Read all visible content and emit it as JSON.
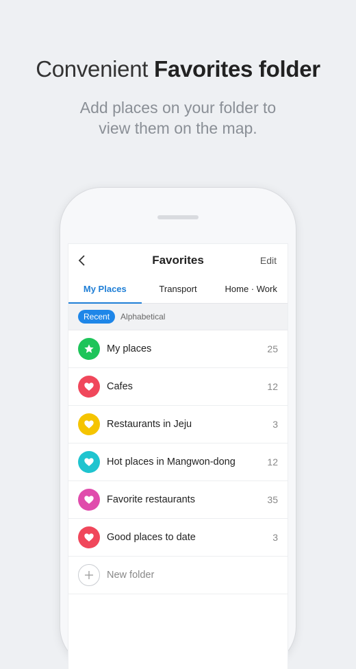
{
  "headline": {
    "light": "Convenient ",
    "bold": "Favorites folder"
  },
  "subline": {
    "line1": "Add places on your folder to",
    "line2": "view them on the map."
  },
  "navbar": {
    "title": "Favorites",
    "edit_label": "Edit"
  },
  "tabs": [
    {
      "label": "My Places",
      "active": true
    },
    {
      "label": "Transport",
      "active": false
    },
    {
      "label": "Home · Work",
      "active": false
    }
  ],
  "sort": {
    "recent_label": "Recent",
    "alpha_label": "Alphabetical"
  },
  "folders": [
    {
      "name": "My places",
      "count": "25",
      "icon": "star-icon",
      "color": "#1ec45a"
    },
    {
      "name": "Cafes",
      "count": "12",
      "icon": "heart-icon",
      "color": "#f0475b"
    },
    {
      "name": "Restaurants in Jeju",
      "count": "3",
      "icon": "heart-icon",
      "color": "#f5c400"
    },
    {
      "name": "Hot places in Mangwon-dong",
      "count": "12",
      "icon": "heart-icon",
      "color": "#1fc4cf"
    },
    {
      "name": "Favorite restaurants",
      "count": "35",
      "icon": "heart-icon",
      "color": "#e04cac"
    },
    {
      "name": "Good places to date",
      "count": "3",
      "icon": "heart-icon",
      "color": "#f0475b"
    }
  ],
  "new_folder": {
    "label": "New folder",
    "icon": "plus-icon"
  },
  "colors": {
    "accent": "#1e7ed6",
    "background": "#eef0f3"
  }
}
